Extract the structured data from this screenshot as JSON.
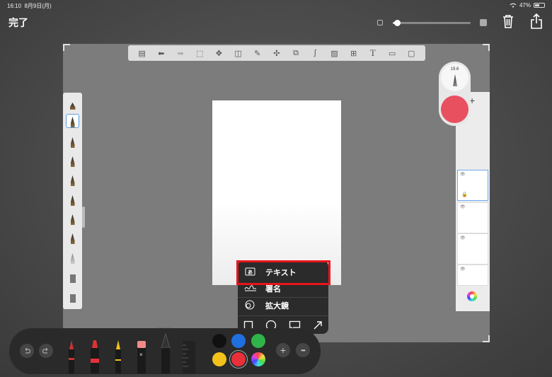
{
  "status": {
    "time": "16:10",
    "date": "8月9日(月)",
    "battery": "47%"
  },
  "topbar": {
    "done_label": "完了",
    "zoom_level": 0.05
  },
  "right_pill": {
    "brush_size": "19.6",
    "current_color": "#e8505f"
  },
  "layer_panel": {
    "add_label": "+"
  },
  "popup_menu": {
    "items": [
      {
        "icon": "text-box-icon",
        "label": "テキスト"
      },
      {
        "icon": "signature-icon",
        "label": "署名"
      },
      {
        "icon": "magnifier-icon",
        "label": "拡大鏡"
      }
    ],
    "shapes": [
      "square-icon",
      "circle-icon",
      "speech-bubble-icon",
      "arrow-icon"
    ]
  },
  "dock": {
    "colors": [
      "#111111",
      "#1f6fe0",
      "#2fb44a",
      "#f2c21c",
      "#e8303a",
      "color-wheel"
    ],
    "plus_label": "+",
    "more_label": "•••"
  },
  "accent": "#e8151b"
}
